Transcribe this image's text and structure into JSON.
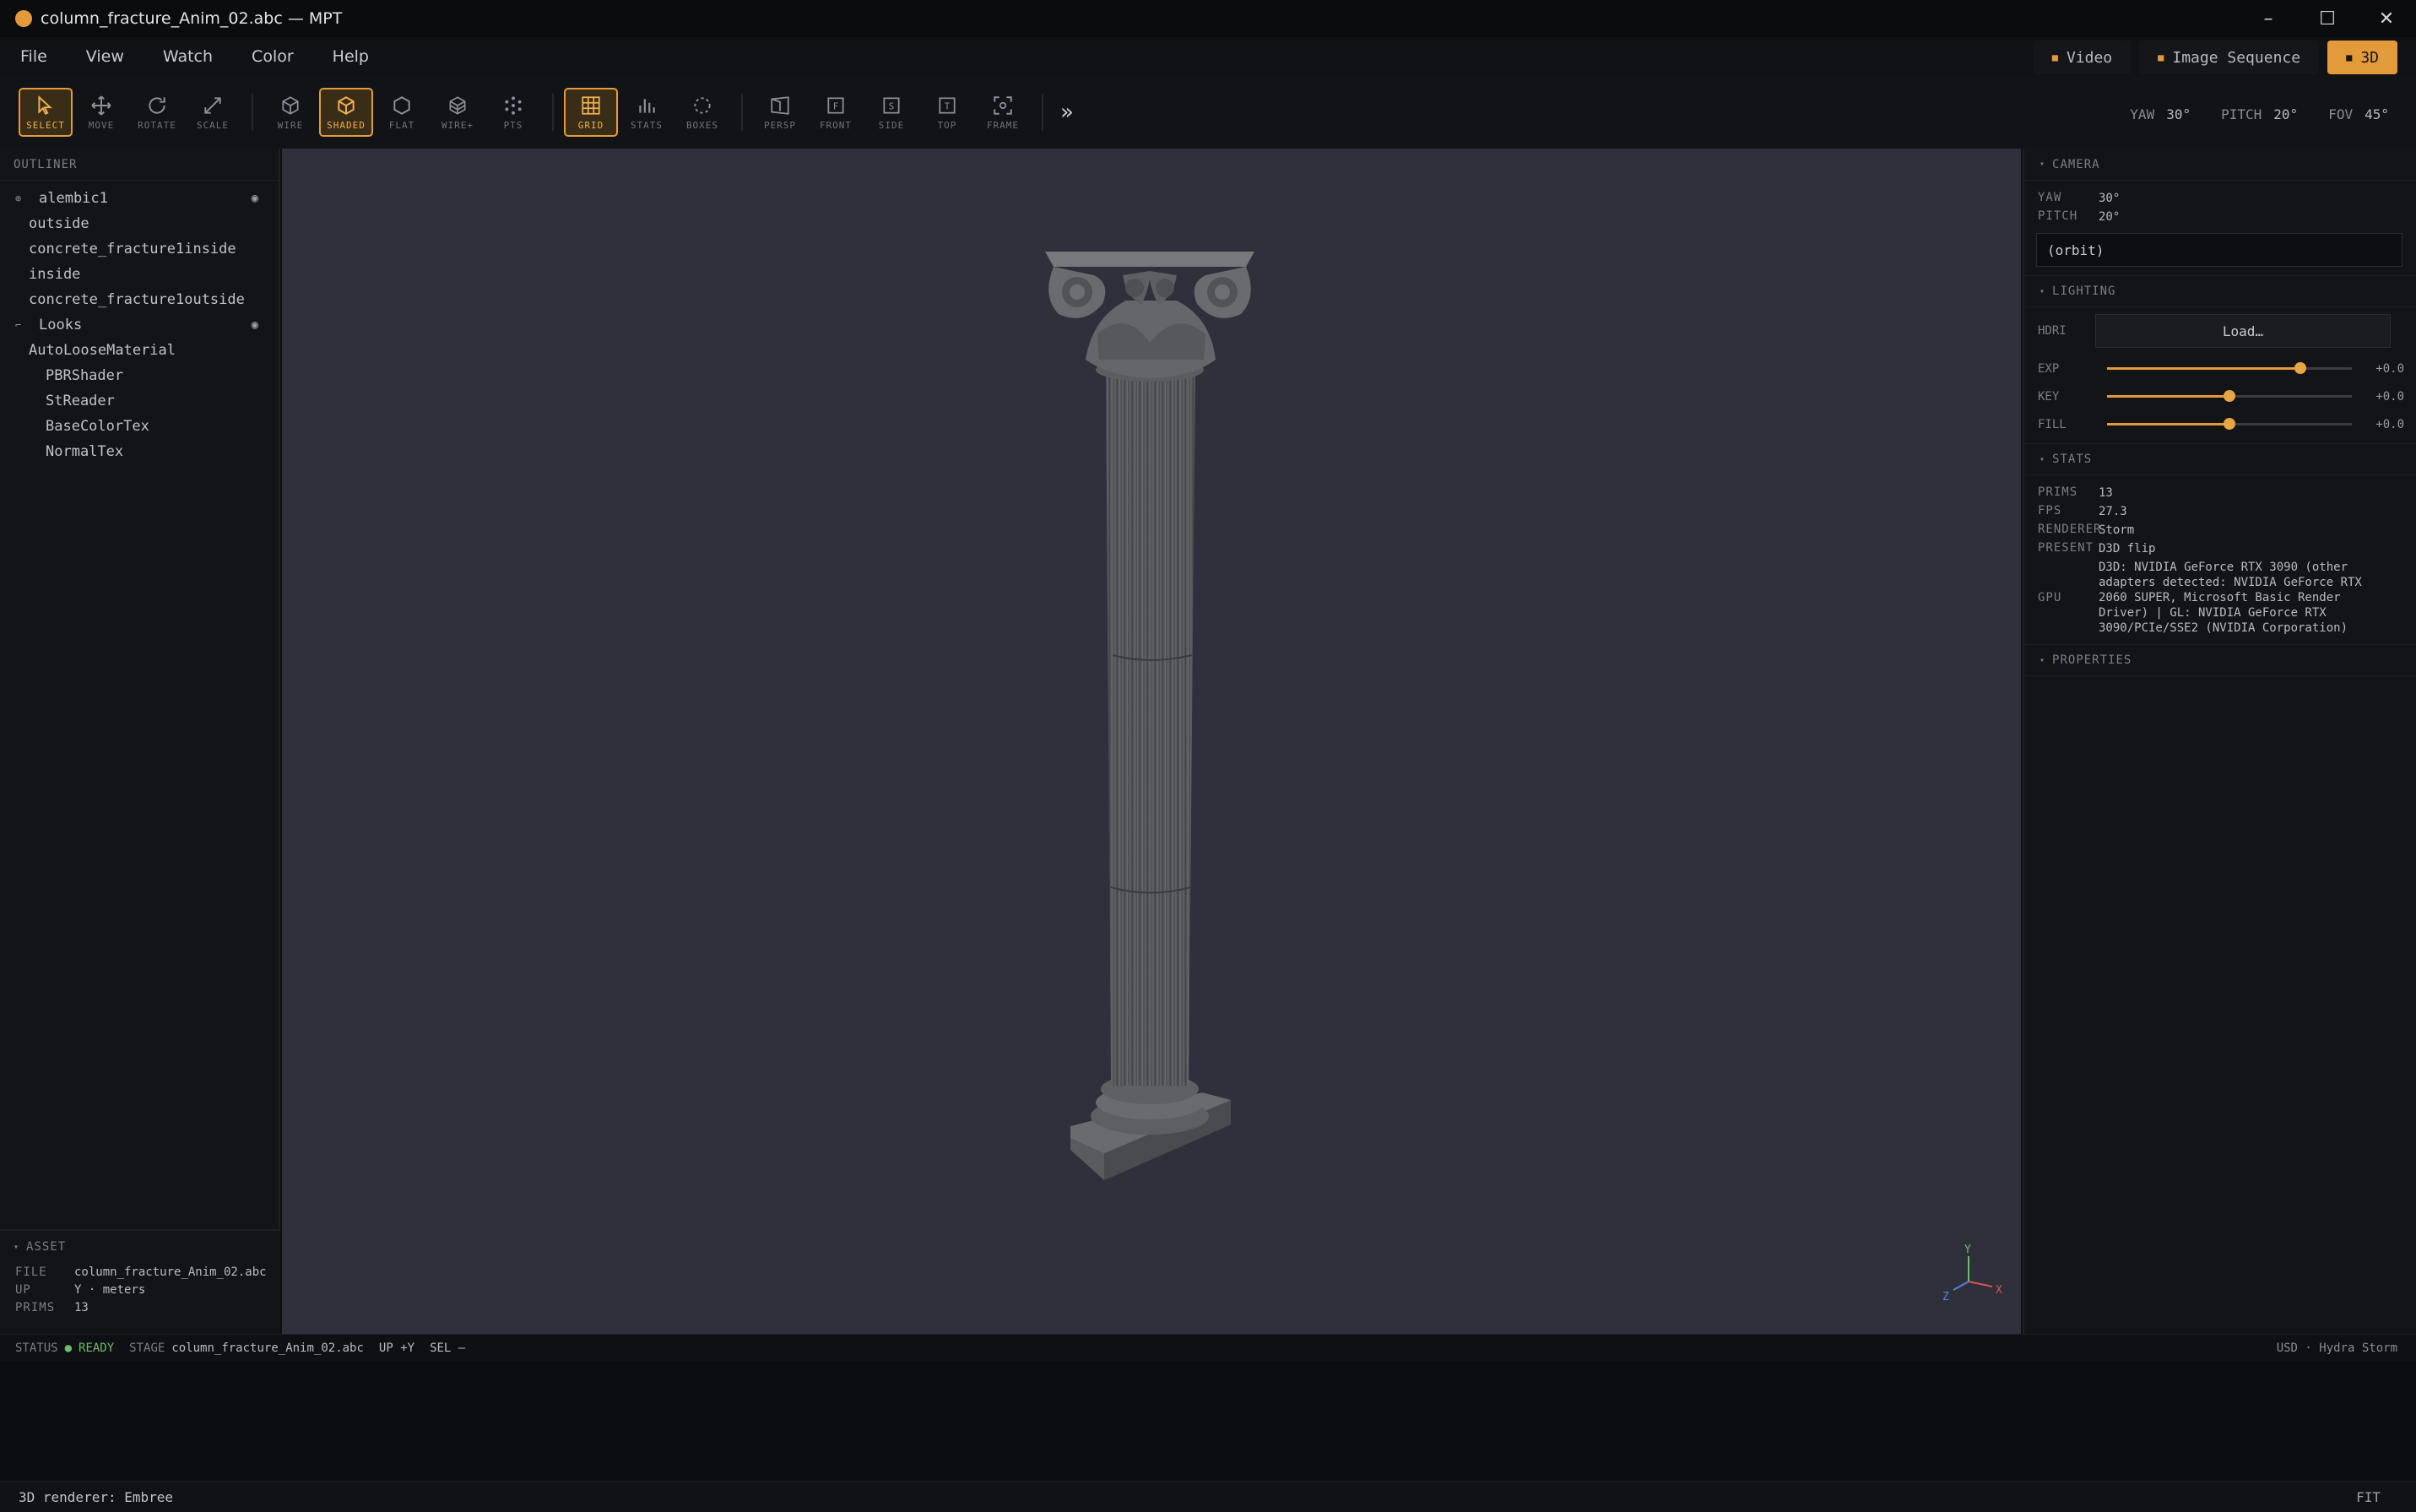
{
  "window": {
    "title": "column_fracture_Anim_02.abc — MPT"
  },
  "menu": [
    "File",
    "View",
    "Watch",
    "Color",
    "Help"
  ],
  "modes": [
    {
      "label": "Video",
      "active": false
    },
    {
      "label": "Image Sequence",
      "active": false
    },
    {
      "label": "3D",
      "active": true
    }
  ],
  "tools": {
    "select": "SELECT",
    "move": "MOVE",
    "rotate": "ROTATE",
    "scale": "SCALE",
    "wire": "WIRE",
    "shaded": "SHADED",
    "flat": "FLAT",
    "wireplus": "WIRE+",
    "pts": "PTS",
    "grid": "GRID",
    "stats": "STATS",
    "boxes": "BOXES",
    "persp": "PERSP",
    "front": "FRONT",
    "side": "SIDE",
    "top": "TOP",
    "frame": "FRAME",
    "front_glyph": "F",
    "side_glyph": "S",
    "top_glyph": "T",
    "more": "»"
  },
  "camera_readout": {
    "yaw_k": "YAW",
    "yaw": "30°",
    "pitch_k": "PITCH",
    "pitch": "20°",
    "fov_k": "FOV",
    "fov": "45°"
  },
  "outliner": {
    "title": "OUTLINER",
    "items": [
      {
        "label": "alembic1",
        "indent": 0,
        "caret": true,
        "eye": true
      },
      {
        "label": "outside",
        "indent": 1
      },
      {
        "label": "concrete_fracture1inside",
        "indent": 1
      },
      {
        "label": "inside",
        "indent": 1
      },
      {
        "label": "concrete_fracture1outside",
        "indent": 1
      },
      {
        "label": "Looks",
        "indent": 0,
        "caret": true,
        "eye": true
      },
      {
        "label": "AutoLooseMaterial",
        "indent": 1
      },
      {
        "label": "PBRShader",
        "indent": 2
      },
      {
        "label": "StReader",
        "indent": 2
      },
      {
        "label": "BaseColorTex",
        "indent": 2
      },
      {
        "label": "NormalTex",
        "indent": 2
      }
    ]
  },
  "asset": {
    "title": "ASSET",
    "file_k": "FILE",
    "file": "column_fracture_Anim_02.abc",
    "up_k": "UP",
    "up": "Y · meters",
    "prims_k": "PRIMS",
    "prims": "13"
  },
  "camera_panel": {
    "title": "CAMERA",
    "yaw_k": "YAW",
    "yaw": "30°",
    "pitch_k": "PITCH",
    "pitch": "20°",
    "mode": "(orbit)"
  },
  "lighting": {
    "title": "LIGHTING",
    "hdri_k": "HDRI",
    "load": "Load…",
    "sliders": [
      {
        "label": "EXP",
        "value": 0.79,
        "readout": "+0.0"
      },
      {
        "label": "KEY",
        "value": 0.5,
        "readout": "+0.0"
      },
      {
        "label": "FILL",
        "value": 0.5,
        "readout": "+0.0"
      }
    ]
  },
  "stats": {
    "title": "STATS",
    "prims_k": "PRIMS",
    "prims": "13",
    "fps_k": "FPS",
    "fps": "27.3",
    "renderer_k": "RENDERER",
    "renderer": "Storm",
    "present_k": "PRESENT",
    "present": "D3D flip",
    "gpu_k": "GPU",
    "gpu": "D3D: NVIDIA GeForce RTX 3090 (other adapters detected: NVIDIA GeForce RTX 2060 SUPER, Microsoft Basic Render Driver) | GL: NVIDIA GeForce RTX 3090/PCIe/SSE2 (NVIDIA Corporation)"
  },
  "properties": {
    "title": "PROPERTIES"
  },
  "statusbar": {
    "status_k": "STATUS",
    "status": "READY",
    "stage_k": "STAGE",
    "stage": "column_fracture_Anim_02.abc",
    "up": "UP +Y",
    "sel": "SEL —",
    "right": "USD · Hydra Storm"
  },
  "axis": {
    "x": "X",
    "y": "Y",
    "z": "Z"
  },
  "bottom": {
    "msg": "3D renderer: Embree",
    "fit": "FIT"
  },
  "colors": {
    "accent": "#e29a3a",
    "viewport": "#2f303b",
    "ready": "#6dbb6a"
  }
}
